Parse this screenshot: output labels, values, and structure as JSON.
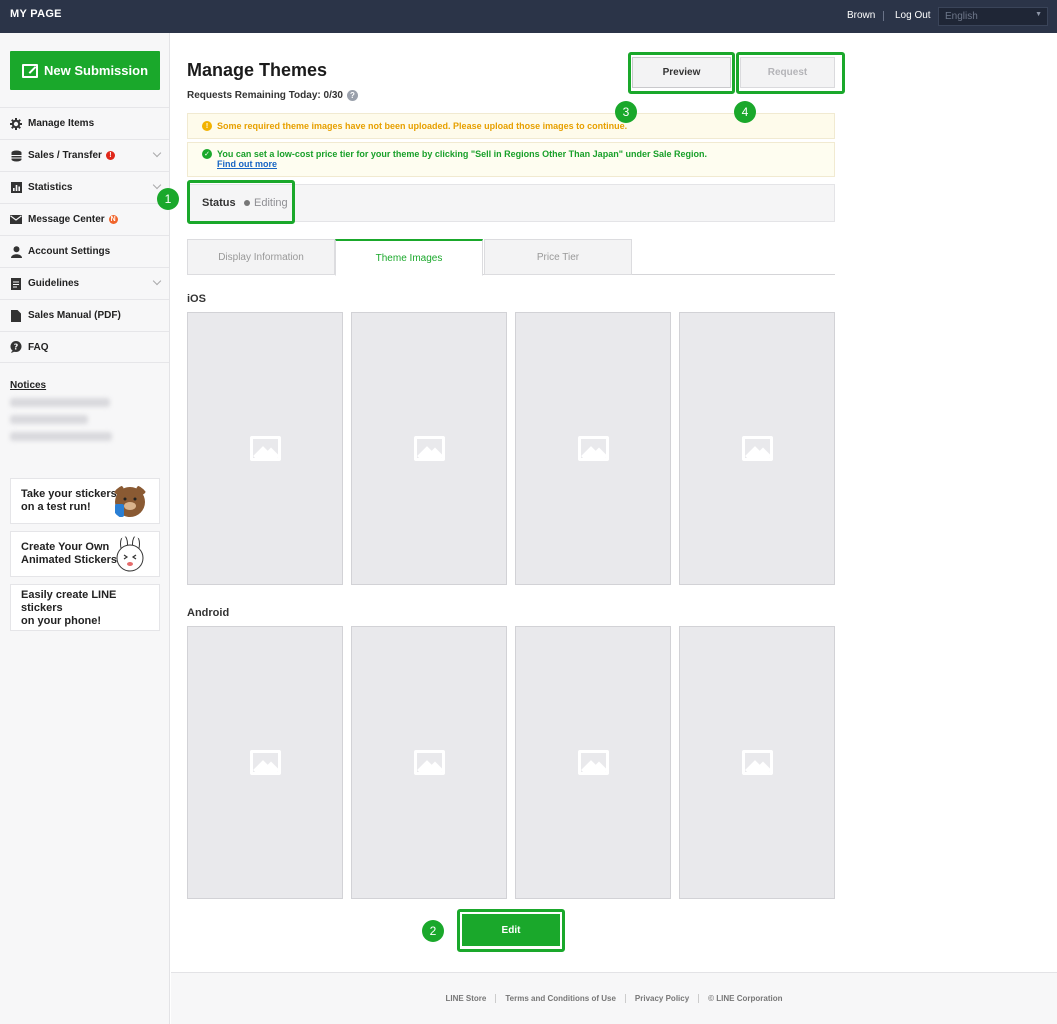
{
  "header": {
    "brand": "MY PAGE",
    "user": "Brown",
    "logout": "Log Out",
    "language": "English"
  },
  "sidebar": {
    "new_submission": "New Submission",
    "items": [
      {
        "label": "Manage Items",
        "icon": "gear-icon"
      },
      {
        "label": "Sales / Transfer",
        "icon": "coins-icon",
        "badge": "!"
      },
      {
        "label": "Statistics",
        "icon": "chart-icon"
      },
      {
        "label": "Message Center",
        "icon": "envelope-icon",
        "badge": "N"
      },
      {
        "label": "Account Settings",
        "icon": "person-icon"
      },
      {
        "label": "Guidelines",
        "icon": "document-icon"
      },
      {
        "label": "Sales Manual (PDF)",
        "icon": "file-icon"
      },
      {
        "label": "FAQ",
        "icon": "question-bubble-icon"
      }
    ],
    "notices_label": "Notices",
    "promos": [
      {
        "line1": "Take your stickers",
        "line2": "on a test run!"
      },
      {
        "line1": "Create Your Own",
        "line2": "Animated Stickers"
      },
      {
        "line1": "Easily create LINE",
        "line2": "stickers",
        "line3": "on your phone!"
      }
    ]
  },
  "main": {
    "title": "Manage Themes",
    "remaining": "Requests Remaining Today: 0/30",
    "help": "?",
    "preview": "Preview",
    "request": "Request",
    "alert_warning": "Some required theme images have not been uploaded. Please upload those images to continue.",
    "alert_info": "You can set a low-cost price tier for your theme by clicking \"Sell in Regions Other Than Japan\" under Sale Region.",
    "alert_info_link": "Find out more",
    "status_label": "Status",
    "status_value": "Editing",
    "tabs": [
      "Display Information",
      "Theme Images",
      "Price Tier"
    ],
    "ios_label": "iOS",
    "android_label": "Android",
    "edit": "Edit"
  },
  "markers": [
    "1",
    "2",
    "3",
    "4"
  ],
  "footer": {
    "links": [
      "LINE Store",
      "Terms and Conditions of Use",
      "Privacy Policy",
      "© LINE Corporation"
    ]
  },
  "colors": {
    "accent": "#1aa82b",
    "header_bg": "#2b3448",
    "warning": "#e7a000",
    "link": "#1765c4"
  }
}
